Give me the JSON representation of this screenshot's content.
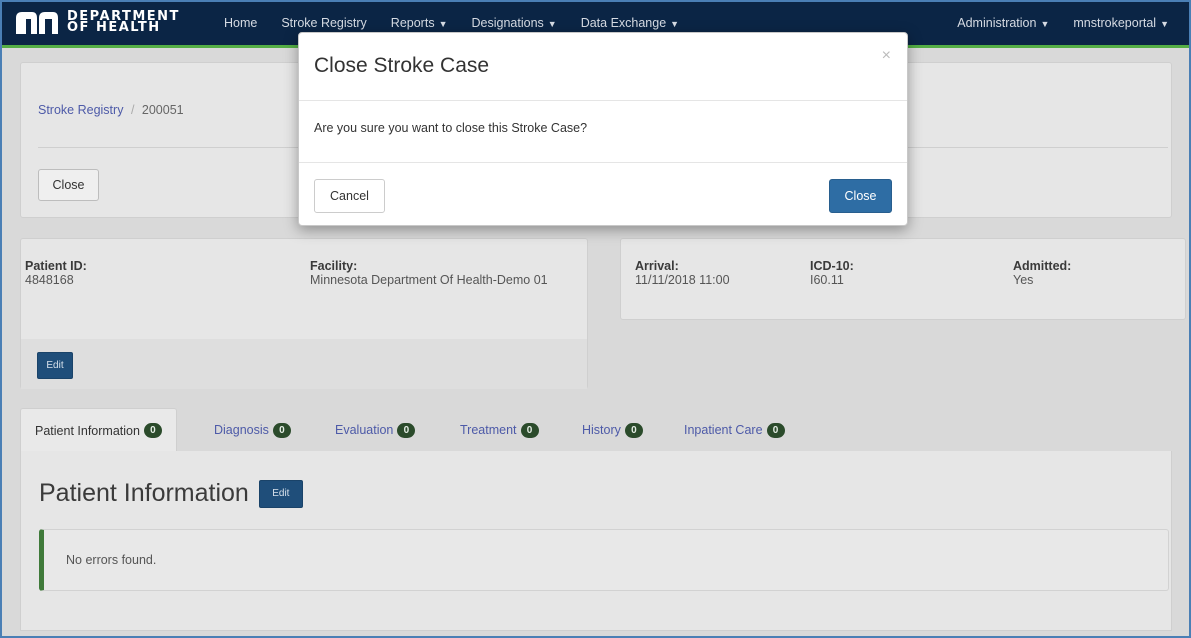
{
  "brand": {
    "line1": "DEPARTMENT",
    "line2": "OF HEALTH"
  },
  "nav": {
    "home": "Home",
    "stroke_registry": "Stroke Registry",
    "reports": "Reports",
    "designations": "Designations",
    "data_exchange": "Data Exchange",
    "administration": "Administration",
    "user": "mnstrokeportal"
  },
  "breadcrumb": {
    "root": "Stroke Registry",
    "separator": "/",
    "current": "200051"
  },
  "toolbar": {
    "close_label": "Close"
  },
  "patient_card": {
    "patient_id_label": "Patient ID:",
    "patient_id": "4848168",
    "facility_label": "Facility:",
    "facility": "Minnesota Department Of Health-Demo 01",
    "edit_label": "Edit"
  },
  "case_card": {
    "arrival_label": "Arrival:",
    "arrival": "11/11/2018 11:00",
    "icd_label": "ICD-10:",
    "icd": "I60.11",
    "admitted_label": "Admitted:",
    "admitted": "Yes"
  },
  "tabs": [
    {
      "label": "Patient Information",
      "count": "0"
    },
    {
      "label": "Diagnosis",
      "count": "0"
    },
    {
      "label": "Evaluation",
      "count": "0"
    },
    {
      "label": "Treatment",
      "count": "0"
    },
    {
      "label": "History",
      "count": "0"
    },
    {
      "label": "Inpatient Care",
      "count": "0"
    }
  ],
  "section": {
    "title": "Patient Information",
    "edit_label": "Edit",
    "message": "No errors found."
  },
  "modal": {
    "title": "Close Stroke Case",
    "close_x": "×",
    "body": "Are you sure you want to close this Stroke Case?",
    "cancel_label": "Cancel",
    "confirm_label": "Close"
  },
  "colors": {
    "navbar": "#0b2545",
    "accent_green": "#54ae45",
    "primary": "#2e6da4",
    "badge": "#2b4b2b"
  }
}
